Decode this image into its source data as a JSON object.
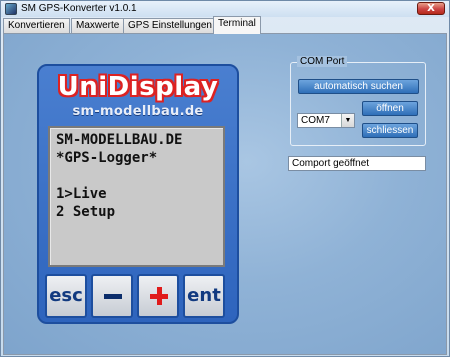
{
  "window": {
    "title": "SM GPS-Konverter v1.0.1",
    "close_label": "X"
  },
  "tabs": [
    {
      "label": "Konvertieren"
    },
    {
      "label": "Maxwerte"
    },
    {
      "label": "GPS Einstellungen"
    },
    {
      "label": "Terminal"
    }
  ],
  "active_tab": "Terminal",
  "device": {
    "logo": "UniDisplay",
    "subtitle": "sm-modellbau.de",
    "lcd_lines": [
      "SM-MODELLBAU.DE",
      "*GPS-Logger*",
      "",
      "1>Live",
      "2 Setup"
    ],
    "keys": {
      "esc": "esc",
      "minus": "−",
      "plus": "+",
      "ent": "ent"
    },
    "colors": {
      "body": "#2e64bd",
      "logo_outline": "#d22222",
      "lcd": "#c9c9c9",
      "plus": "#e01b1b"
    }
  },
  "com_port": {
    "group_title": "COM Port",
    "auto_search_label": "automatisch suchen",
    "open_label": "öffnen",
    "close_label": "schliessen",
    "selected_port": "COM7"
  },
  "status": {
    "text": "Comport geöffnet"
  }
}
